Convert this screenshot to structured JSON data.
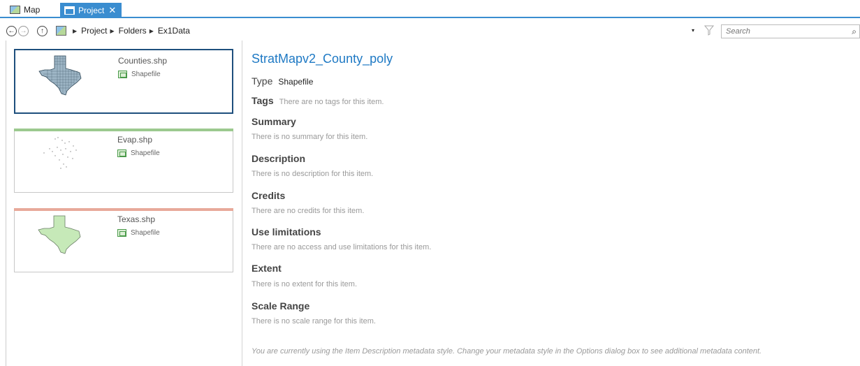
{
  "tabs": {
    "map_label": "Map",
    "project_label": "Project",
    "close_glyph": "✕"
  },
  "toolbar": {
    "breadcrumbs": [
      "Project",
      "Folders",
      "Ex1Data"
    ],
    "search_placeholder": "Search",
    "dropdown_glyph": "▾",
    "search_glyph": "⌕"
  },
  "items": [
    {
      "name": "Counties.shp",
      "type": "Shapefile",
      "accent": "#1e4f7d",
      "selected": true
    },
    {
      "name": "Evap.shp",
      "type": "Shapefile",
      "accent": "#9cc98f",
      "selected": false
    },
    {
      "name": "Texas.shp",
      "type": "Shapefile",
      "accent": "#e8a99a",
      "selected": false
    }
  ],
  "details": {
    "title": "StratMapv2_County_poly",
    "type_label": "Type",
    "type_value": "Shapefile",
    "tags_label": "Tags",
    "tags_value": "There are no tags for this item.",
    "sections": [
      {
        "heading": "Summary",
        "text": "There is no summary for this item."
      },
      {
        "heading": "Description",
        "text": "There is no description for this item."
      },
      {
        "heading": "Credits",
        "text": "There are no credits for this item."
      },
      {
        "heading": "Use limitations",
        "text": "There are no access and use limitations for this item."
      },
      {
        "heading": "Extent",
        "text": "There is no extent for this item."
      },
      {
        "heading": "Scale Range",
        "text": "There is no scale range for this item."
      }
    ],
    "footer": "You are currently using the Item Description metadata style. Change your metadata style in the Options dialog box to see additional metadata content."
  },
  "colors": {
    "accent_blue": "#3a8dd0",
    "title_blue": "#1e79c4"
  }
}
